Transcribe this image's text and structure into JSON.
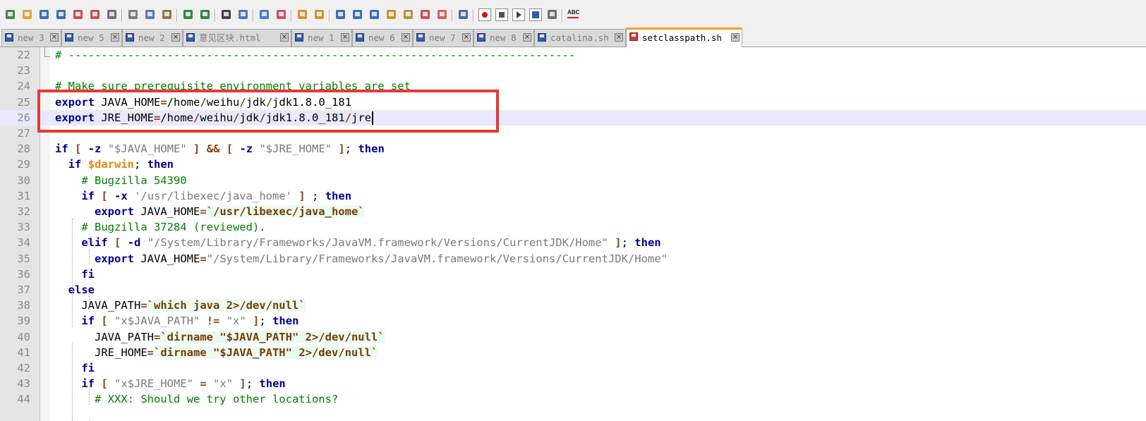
{
  "tabs": [
    {
      "label": "new 3",
      "active": false
    },
    {
      "label": "new 5",
      "active": false
    },
    {
      "label": "new 2",
      "active": false
    },
    {
      "label": "意见区块.html",
      "active": false
    },
    {
      "label": "new 1",
      "active": false
    },
    {
      "label": "new 6",
      "active": false
    },
    {
      "label": "new 7",
      "active": false
    },
    {
      "label": "new 8",
      "active": false
    },
    {
      "label": "catalina.sh",
      "active": false
    },
    {
      "label": "setclasspath.sh",
      "active": true
    }
  ],
  "toolbar": {
    "icons": [
      "new-file-icon",
      "open-file-icon",
      "save-icon",
      "save-all-icon",
      "close-icon",
      "close-all-icon",
      "print-icon",
      "cut-icon",
      "copy-icon",
      "paste-icon",
      "undo-icon",
      "redo-icon",
      "find-icon",
      "replace-icon",
      "zoom-in-icon",
      "zoom-out-icon",
      "sync-vertical-icon",
      "sync-horizontal-icon",
      "word-wrap-icon",
      "show-all-chars-icon",
      "indent-guide-icon",
      "define-language-icon",
      "document-map-icon",
      "function-list-icon",
      "folder-workspace-icon",
      "monitoring-icon",
      "record-macro-icon",
      "stop-macro-icon",
      "play-macro-icon",
      "run-macro-multiple-icon",
      "save-macro-icon",
      "spell-check-icon"
    ],
    "spell_label": "ABC"
  },
  "editor": {
    "lines": [
      {
        "n": "22",
        "html": "<span class=\"cmt\"># -----------------------------------------------------------------------------</span>"
      },
      {
        "n": "23",
        "html": ""
      },
      {
        "n": "24",
        "html": "<span class=\"cmt\"># Make sure prerequisite environment variables are set</span>"
      },
      {
        "n": "25",
        "html": "<span class=\"kw\">export</span> JAVA_HOME<span class=\"op\">=</span>/home<span class=\"op\">/</span>weihu<span class=\"op\">/</span>jdk<span class=\"op\">/</span>jdk1.8.0_181"
      },
      {
        "n": "26",
        "html": "<span class=\"kw\">export</span> JRE_HOME<span class=\"op\">=</span>/home<span class=\"op\">/</span>weihu<span class=\"op\">/</span>jdk<span class=\"op\">/</span>jdk1.8.0_181<span class=\"op\">/</span>jre",
        "current": true
      },
      {
        "n": "27",
        "html": ""
      },
      {
        "n": "28",
        "html": "<span class=\"kw\">if</span> <span class=\"op\">[</span> <span class=\"kw\">-z</span> <span class=\"str\">\"$JAVA_HOME\"</span> <span class=\"op\">]</span> <span class=\"op\">&amp;&amp;</span> <span class=\"op\">[</span> <span class=\"kw\">-z</span> <span class=\"str\">\"$JRE_HOME\"</span> <span class=\"op\">]</span>; <span class=\"kw\">then</span>"
      },
      {
        "n": "29",
        "html": "  <span class=\"kw\">if</span> <span class=\"var\">$darwin</span>; <span class=\"kw\">then</span>"
      },
      {
        "n": "30",
        "html": "    <span class=\"cmt\"># Bugzilla 54390</span>"
      },
      {
        "n": "31",
        "html": "    <span class=\"kw\">if</span> <span class=\"op\">[</span> <span class=\"kw\">-x</span> <span class=\"str\">'/usr/libexec/java_home'</span> <span class=\"op\">]</span> ; <span class=\"kw\">then</span>"
      },
      {
        "n": "32",
        "html": "      <span class=\"kw\">export</span> JAVA_HOME<span class=\"op\">=</span><span class=\"bt\">`/usr/libexec/java_home`</span>"
      },
      {
        "n": "33",
        "html": "    <span class=\"cmt\"># Bugzilla 37284 (reviewed).</span>"
      },
      {
        "n": "34",
        "html": "    <span class=\"kw\">elif</span> <span class=\"op\">[</span> <span class=\"kw\">-d</span> <span class=\"str\">\"/System/Library/Frameworks/JavaVM.framework/Versions/CurrentJDK/Home\"</span> <span class=\"op\">]</span>; <span class=\"kw\">then</span>"
      },
      {
        "n": "35",
        "html": "      <span class=\"kw\">export</span> JAVA_HOME<span class=\"op\">=</span><span class=\"str\">\"/System/Library/Frameworks/JavaVM.framework/Versions/CurrentJDK/Home\"</span>"
      },
      {
        "n": "36",
        "html": "    <span class=\"kw\">fi</span>"
      },
      {
        "n": "37",
        "html": "  <span class=\"kw\">else</span>"
      },
      {
        "n": "38",
        "html": "    JAVA_PATH<span class=\"op\">=</span><span class=\"bt\">`which java 2&gt;/dev/null`</span>"
      },
      {
        "n": "39",
        "html": "    <span class=\"kw\">if</span> <span class=\"op\">[</span> <span class=\"str\">\"x$JAVA_PATH\"</span> <span class=\"op\">!=</span> <span class=\"str\">\"x\"</span> <span class=\"op\">]</span>; <span class=\"kw\">then</span>"
      },
      {
        "n": "40",
        "html": "      JAVA_PATH<span class=\"op\">=</span><span class=\"bt\">`dirname \"$JAVA_PATH\" 2&gt;/dev/null`</span>"
      },
      {
        "n": "41",
        "html": "      JRE_HOME<span class=\"op\">=</span><span class=\"bt\">`dirname \"$JAVA_PATH\" 2&gt;/dev/null`</span>"
      },
      {
        "n": "42",
        "html": "    <span class=\"kw\">fi</span>"
      },
      {
        "n": "43",
        "html": "    <span class=\"kw\">if</span> <span class=\"op\">[</span> <span class=\"str\">\"x$JRE_HOME\"</span> <span class=\"op\">=</span> <span class=\"str\">\"x\"</span> <span class=\"op\">]</span>; <span class=\"kw\">then</span>"
      },
      {
        "n": "44",
        "html": "      <span class=\"cmt\"># XXX: Should we try other locations?</span>"
      }
    ]
  },
  "colors": {
    "keyword": "#00008b",
    "variable": "#e8870c",
    "string": "#7a7a7a",
    "comment": "#008000",
    "operator": "#8b4513",
    "current_line": "#e8e8ff",
    "highlight_box": "#e53935",
    "active_tab_accent": "#fa9e1e"
  }
}
